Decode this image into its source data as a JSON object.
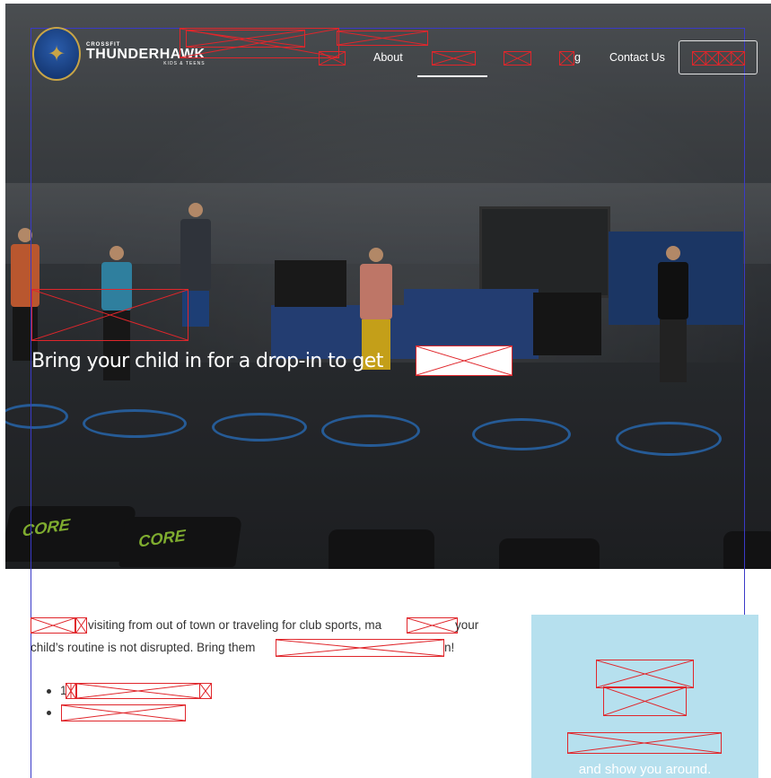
{
  "brand": {
    "crossfit_label": "CROSSFIT",
    "name": "THUNDERHAWK",
    "tagline": "KIDS & TEENS"
  },
  "nav": {
    "items": [
      {
        "label": "About",
        "active": true
      },
      {
        "label": "g",
        "active": false
      },
      {
        "label": "Contact Us",
        "active": false
      }
    ]
  },
  "hero": {
    "tagline": "Bring your child in for a drop-in to get"
  },
  "content": {
    "para_line1_fragment_a": "visiting from out of town or traveling for club sports, ma",
    "para_line1_fragment_b": "your",
    "para_line2_fragment_a": "child’s routine is not disrupted. Bring them",
    "para_line2_fragment_b": "n!",
    "bullet1_prefix": "1"
  },
  "sidebar": {
    "visible_text": "and show you around."
  },
  "colors": {
    "placeholder_border": "#e0262b",
    "guide_border": "#3a3ac8",
    "sidebar_bg": "#b6e0ee",
    "nav_text": "#ffffff"
  }
}
